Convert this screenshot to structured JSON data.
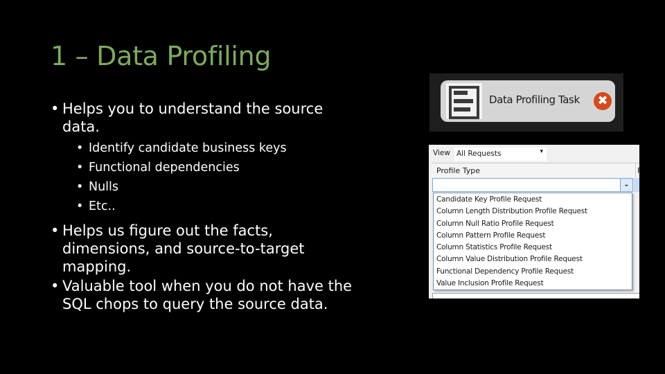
{
  "slide": {
    "title": "1 – Data Profiling",
    "title_color": "#7cab5c",
    "bullets": [
      {
        "text_line1": "Helps you to understand the source",
        "text_line2": "data.",
        "sub_items": [
          "Identify candidate business keys",
          "Functional dependencies",
          "Nulls",
          "Etc.."
        ]
      },
      {
        "text_line1": "Helps us figure out the facts,",
        "text_line2": "dimensions, and source-to-target",
        "text_line3": "mapping."
      },
      {
        "text_line1": "Valuable tool when you do not have the",
        "text_line2": "SQL chops to query the source data."
      }
    ],
    "bullet_glyph": "•"
  },
  "task_screenshot": {
    "icon": "data-profiling-task-icon",
    "label": "Data Profiling Task",
    "status_icon": "error-icon",
    "status_glyph": "✖",
    "status_color": "#d74a1a"
  },
  "dialog_screenshot": {
    "view_label": "View",
    "view_value": "All Requests",
    "view_caret": "▾",
    "column_header": "Profile Type",
    "column_header_next": "F",
    "combo_value": "",
    "combo_caret": "⌄",
    "options": [
      "Candidate Key Profile Request",
      "Column Length Distribution Profile Request",
      "Column Null Ratio Profile Request",
      "Column Pattern Profile Request",
      "Column Statistics Profile Request",
      "Column Value Distribution Profile Request",
      "Functional Dependency Profile Request",
      "Value Inclusion Profile Request"
    ]
  }
}
